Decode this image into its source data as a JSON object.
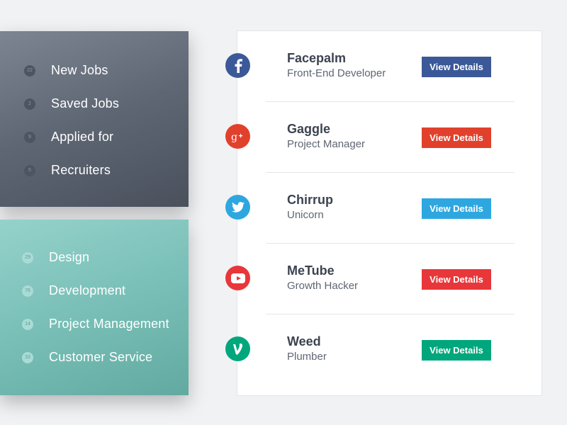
{
  "primary_menu": [
    {
      "count": "22",
      "label": "New Jobs"
    },
    {
      "count": "2",
      "label": "Saved Jobs"
    },
    {
      "count": "9",
      "label": "Applied for"
    },
    {
      "count": "5",
      "label": "Recruiters"
    }
  ],
  "category_menu": [
    {
      "count": "29",
      "label": "Design"
    },
    {
      "count": "76",
      "label": "Development"
    },
    {
      "count": "14",
      "label": "Project Management"
    },
    {
      "count": "33",
      "label": "Customer Service"
    }
  ],
  "jobs": [
    {
      "company": "Facepalm",
      "role": "Front-End Developer",
      "button": "View Details",
      "color": "#3b5998",
      "icon": "facebook-icon"
    },
    {
      "company": "Gaggle",
      "role": "Project Manager",
      "button": "View Details",
      "color": "#e1412c",
      "icon": "google-plus-icon"
    },
    {
      "company": "Chirrup",
      "role": "Unicorn",
      "button": "View Details",
      "color": "#2ea7e0",
      "icon": "twitter-icon"
    },
    {
      "company": "MeTube",
      "role": "Growth Hacker",
      "button": "View Details",
      "color": "#e8373a",
      "icon": "youtube-icon"
    },
    {
      "company": "Weed",
      "role": "Plumber",
      "button": "View Details",
      "color": "#00a77c",
      "icon": "vine-icon"
    }
  ]
}
